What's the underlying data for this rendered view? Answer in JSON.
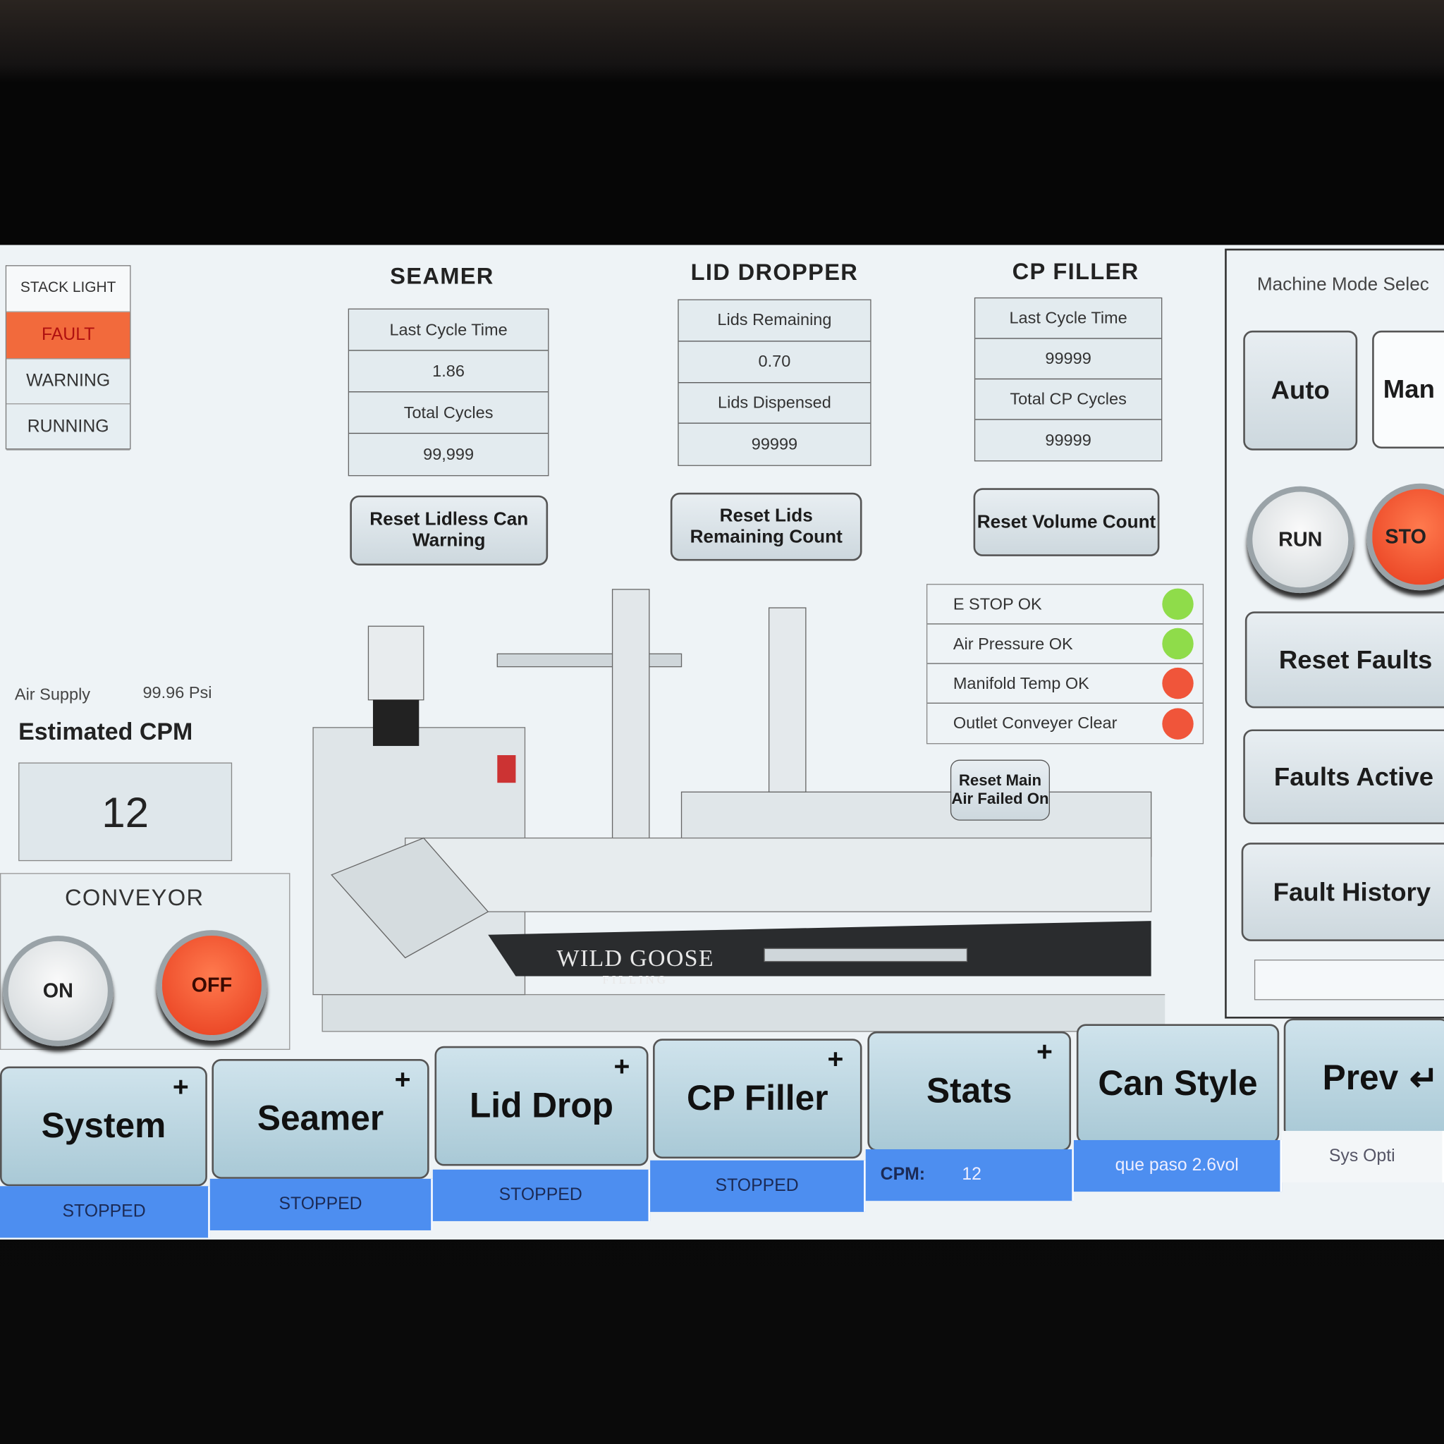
{
  "stack_light": {
    "title": "STACK LIGHT",
    "items": [
      "FAULT",
      "WARNING",
      "RUNNING"
    ],
    "active": "FAULT",
    "fault_color": "#f26a3c"
  },
  "seamer": {
    "title": "SEAMER",
    "rows": [
      "Last Cycle Time",
      "1.86",
      "Total Cycles",
      "99,999"
    ],
    "button": "Reset Lidless Can Warning"
  },
  "lid_dropper": {
    "title": "LID DROPPER",
    "rows": [
      "Lids Remaining",
      "0.70",
      "Lids Dispensed",
      "99999"
    ],
    "button": "Reset Lids Remaining Count"
  },
  "cp_filler": {
    "title": "CP FILLER",
    "rows": [
      "Last Cycle Time",
      "99999",
      "Total CP Cycles",
      "99999"
    ],
    "button": "Reset Volume Count"
  },
  "air_supply": {
    "label": "Air Supply",
    "value": "99.96 Psi"
  },
  "estimated_cpm": {
    "label": "Estimated CPM",
    "value": "12"
  },
  "conveyor": {
    "title": "CONVEYOR",
    "on": "ON",
    "off": "OFF"
  },
  "status_list": [
    {
      "label": "E STOP OK",
      "color": "#8fdc4a"
    },
    {
      "label": "Air Pressure OK",
      "color": "#8fdc4a"
    },
    {
      "label": "Manifold Temp OK",
      "color": "#f0553a"
    },
    {
      "label": "Outlet Conveyer Clear",
      "color": "#f0553a"
    }
  ],
  "reset_main_air": "Reset Main Air Failed On",
  "machine_logo": {
    "name": "WILD GOOSE",
    "sub": "FILLING"
  },
  "mode": {
    "title": "Machine Mode Selec",
    "auto": "Auto",
    "manual": "Man",
    "run": "RUN",
    "stop": "STO",
    "reset_faults": "Reset Faults",
    "faults_active": "Faults Active",
    "fault_history": "Fault History"
  },
  "tabs": [
    {
      "label": "System",
      "plus": "+",
      "status": "STOPPED"
    },
    {
      "label": "Seamer",
      "plus": "+",
      "status": "STOPPED"
    },
    {
      "label": "Lid Drop",
      "plus": "+",
      "status": "STOPPED"
    },
    {
      "label": "CP Filler",
      "plus": "+",
      "status": "STOPPED"
    },
    {
      "label": "Stats",
      "plus": "+",
      "status_label": "CPM:",
      "status_value": "12"
    },
    {
      "label": "Can Style",
      "status": "que paso 2.6vol"
    },
    {
      "label": "Prev",
      "icon": "return-arrow-icon",
      "status": "Sys Opti"
    }
  ]
}
